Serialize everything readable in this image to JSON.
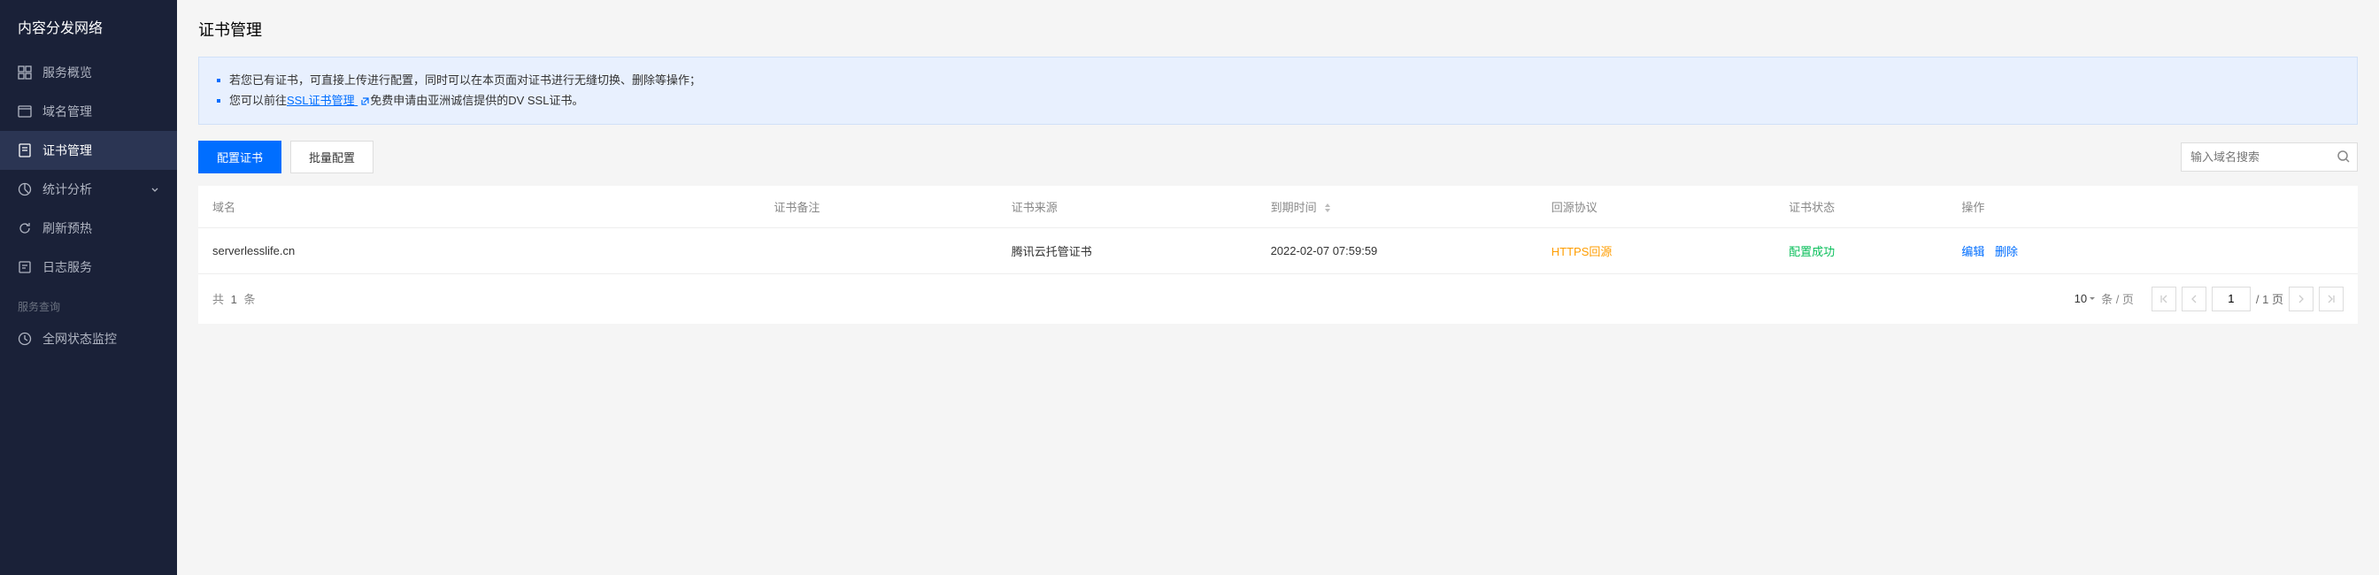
{
  "sidebar": {
    "title": "内容分发网络",
    "items": [
      {
        "label": "服务概览"
      },
      {
        "label": "域名管理"
      },
      {
        "label": "证书管理"
      },
      {
        "label": "统计分析"
      },
      {
        "label": "刷新预热"
      },
      {
        "label": "日志服务"
      }
    ],
    "section_label": "服务查询",
    "section_items": [
      {
        "label": "全网状态监控"
      }
    ]
  },
  "page": {
    "title": "证书管理"
  },
  "info": {
    "line1": "若您已有证书，可直接上传进行配置，同时可以在本页面对证书进行无缝切换、删除等操作；",
    "line2_prefix": "您可以前往",
    "line2_link": "SSL证书管理",
    "line2_suffix": " 免费申请由亚洲诚信提供的DV SSL证书。"
  },
  "toolbar": {
    "configure_btn": "配置证书",
    "batch_btn": "批量配置",
    "search_placeholder": "输入域名搜索"
  },
  "table": {
    "headers": {
      "domain": "域名",
      "remark": "证书备注",
      "source": "证书来源",
      "expire": "到期时间",
      "protocol": "回源协议",
      "status": "证书状态",
      "action": "操作"
    },
    "rows": [
      {
        "domain": "serverlesslife.cn",
        "remark": "",
        "source": "腾讯云托管证书",
        "expire": "2022-02-07 07:59:59",
        "protocol": "HTTPS回源",
        "status": "配置成功",
        "edit": "编辑",
        "delete": "删除"
      }
    ]
  },
  "pagination": {
    "total_prefix": "共",
    "total_count": "1",
    "total_suffix": "条",
    "page_size": "10",
    "page_size_suffix": "条 / 页",
    "current_page": "1",
    "total_pages": "/ 1 页"
  }
}
